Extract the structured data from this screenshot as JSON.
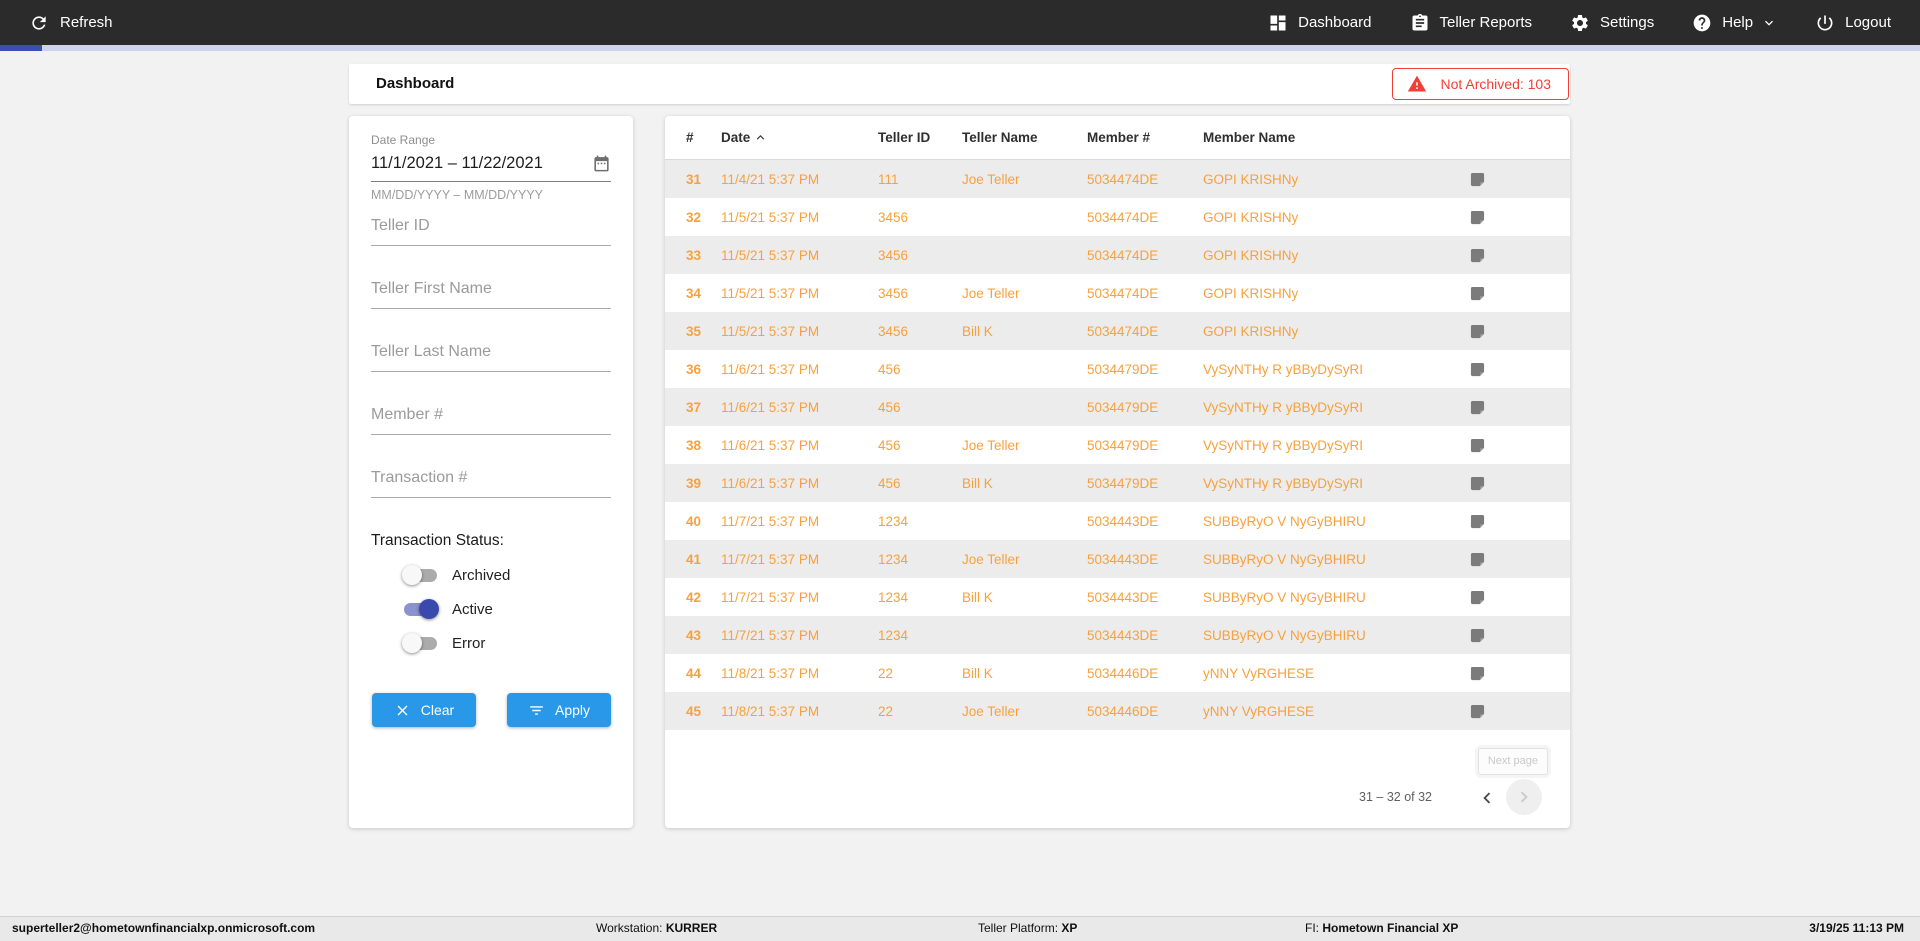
{
  "topbar": {
    "refresh_label": "Refresh",
    "nav": [
      {
        "label": "Dashboard"
      },
      {
        "label": "Teller Reports"
      },
      {
        "label": "Settings"
      },
      {
        "label": "Help"
      },
      {
        "label": "Logout"
      }
    ]
  },
  "header": {
    "title": "Dashboard",
    "not_archived_badge": "Not Archived: 103"
  },
  "filters": {
    "date_range": {
      "label": "Date Range",
      "value": "11/1/2021 – 11/22/2021",
      "hint": "MM/DD/YYYY – MM/DD/YYYY"
    },
    "fields": [
      {
        "placeholder": "Teller ID"
      },
      {
        "placeholder": "Teller First Name"
      },
      {
        "placeholder": "Teller Last Name"
      },
      {
        "placeholder": "Member #"
      },
      {
        "placeholder": "Transaction #"
      }
    ],
    "status_label": "Transaction Status:",
    "toggles": [
      {
        "label": "Archived",
        "on": false
      },
      {
        "label": "Active",
        "on": true
      },
      {
        "label": "Error",
        "on": false
      }
    ],
    "clear_label": "Clear",
    "apply_label": "Apply"
  },
  "table": {
    "columns": [
      "#",
      "Date",
      "Teller ID",
      "Teller Name",
      "Member #",
      "Member Name"
    ],
    "sorted_by": "Date",
    "sort_direction": "ascending",
    "rows": [
      {
        "num": "31",
        "date": "11/4/21 5:37 PM",
        "teller_id": "111",
        "teller_name": "Joe Teller",
        "member_num": "5034474DE",
        "member_name": "GOPI KRISHNy"
      },
      {
        "num": "32",
        "date": "11/5/21 5:37 PM",
        "teller_id": "3456",
        "teller_name": "",
        "member_num": "5034474DE",
        "member_name": "GOPI KRISHNy"
      },
      {
        "num": "33",
        "date": "11/5/21 5:37 PM",
        "teller_id": "3456",
        "teller_name": "",
        "member_num": "5034474DE",
        "member_name": "GOPI KRISHNy"
      },
      {
        "num": "34",
        "date": "11/5/21 5:37 PM",
        "teller_id": "3456",
        "teller_name": "Joe Teller",
        "member_num": "5034474DE",
        "member_name": "GOPI KRISHNy"
      },
      {
        "num": "35",
        "date": "11/5/21 5:37 PM",
        "teller_id": "3456",
        "teller_name": "Bill K",
        "member_num": "5034474DE",
        "member_name": "GOPI KRISHNy"
      },
      {
        "num": "36",
        "date": "11/6/21 5:37 PM",
        "teller_id": "456",
        "teller_name": "",
        "member_num": "5034479DE",
        "member_name": "VySyNTHy R yBByDySyRI"
      },
      {
        "num": "37",
        "date": "11/6/21 5:37 PM",
        "teller_id": "456",
        "teller_name": "",
        "member_num": "5034479DE",
        "member_name": "VySyNTHy R yBByDySyRI"
      },
      {
        "num": "38",
        "date": "11/6/21 5:37 PM",
        "teller_id": "456",
        "teller_name": "Joe Teller",
        "member_num": "5034479DE",
        "member_name": "VySyNTHy R yBByDySyRI"
      },
      {
        "num": "39",
        "date": "11/6/21 5:37 PM",
        "teller_id": "456",
        "teller_name": "Bill K",
        "member_num": "5034479DE",
        "member_name": "VySyNTHy R yBByDySyRI"
      },
      {
        "num": "40",
        "date": "11/7/21 5:37 PM",
        "teller_id": "1234",
        "teller_name": "",
        "member_num": "5034443DE",
        "member_name": "SUBByRyO V NyGyBHIRU"
      },
      {
        "num": "41",
        "date": "11/7/21 5:37 PM",
        "teller_id": "1234",
        "teller_name": "Joe Teller",
        "member_num": "5034443DE",
        "member_name": "SUBByRyO V NyGyBHIRU"
      },
      {
        "num": "42",
        "date": "11/7/21 5:37 PM",
        "teller_id": "1234",
        "teller_name": "Bill K",
        "member_num": "5034443DE",
        "member_name": "SUBByRyO V NyGyBHIRU"
      },
      {
        "num": "43",
        "date": "11/7/21 5:37 PM",
        "teller_id": "1234",
        "teller_name": "",
        "member_num": "5034443DE",
        "member_name": "SUBByRyO V NyGyBHIRU"
      },
      {
        "num": "44",
        "date": "11/8/21 5:37 PM",
        "teller_id": "22",
        "teller_name": "Bill K",
        "member_num": "5034446DE",
        "member_name": "yNNY VyRGHESE"
      },
      {
        "num": "45",
        "date": "11/8/21 5:37 PM",
        "teller_id": "22",
        "teller_name": "Joe Teller",
        "member_num": "5034446DE",
        "member_name": "yNNY VyRGHESE"
      }
    ]
  },
  "pagination": {
    "next_page_label": "Next page",
    "range_label": "31 – 32 of 32"
  },
  "statusbar": {
    "user": "superteller2@hometownfinancialxp.onmicrosoft.com",
    "workstation_label": "Workstation:",
    "workstation_value": "KURRER",
    "platform_label": "Teller Platform:",
    "platform_value": "XP",
    "fi_label": "FI:",
    "fi_value": "Hometown Financial XP",
    "datetime": "3/19/25 11:13 PM"
  },
  "colors": {
    "topbar_bg": "#2b2b2b",
    "accent_orange": "#f8a13c",
    "alert_red": "#f23f36",
    "button_blue": "#2998e8",
    "toggle_on_knob": "#3a49ae",
    "toggle_on_track": "#8b93cf",
    "progress_track": "#cdd3ec",
    "progress_fill": "#3b4eb2",
    "row_alt_bg": "#ececec"
  }
}
